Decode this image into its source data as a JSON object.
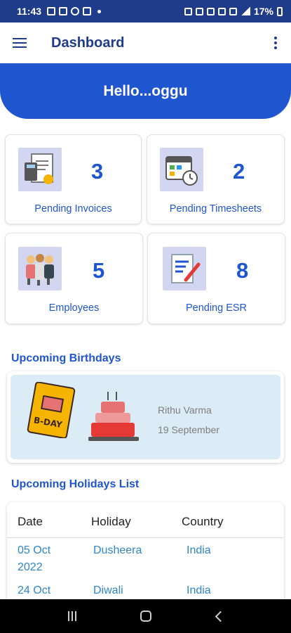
{
  "status_bar": {
    "time": "11:43",
    "battery": "17%"
  },
  "app_bar": {
    "title": "Dashboard"
  },
  "greeting": "Hello...oggu",
  "stats": [
    {
      "count": "3",
      "label": "Pending Invoices",
      "icon": "invoice-calculator-icon"
    },
    {
      "count": "2",
      "label": "Pending Timesheets",
      "icon": "calendar-clock-icon"
    },
    {
      "count": "5",
      "label": "Employees",
      "icon": "employees-group-icon"
    },
    {
      "count": "8",
      "label": "Pending ESR",
      "icon": "document-pen-icon"
    }
  ],
  "birthdays": {
    "title": "Upcoming Birthdays",
    "card_text": "B-DAY",
    "items": [
      {
        "name": "Rithu Varma",
        "date": "19 September"
      }
    ]
  },
  "holidays": {
    "title": "Upcoming Holidays List",
    "columns": [
      "Date",
      "Holiday",
      "Country"
    ],
    "rows": [
      {
        "date": "05 Oct 2022",
        "holiday": "Dusheera",
        "country": "India"
      },
      {
        "date": "24 Oct",
        "holiday": "Diwali",
        "country": "India"
      }
    ]
  },
  "colors": {
    "primary": "#1f3c8a",
    "accent": "#1f55cf",
    "link": "#2f86c7",
    "birthday_bg": "#dbecf7"
  }
}
